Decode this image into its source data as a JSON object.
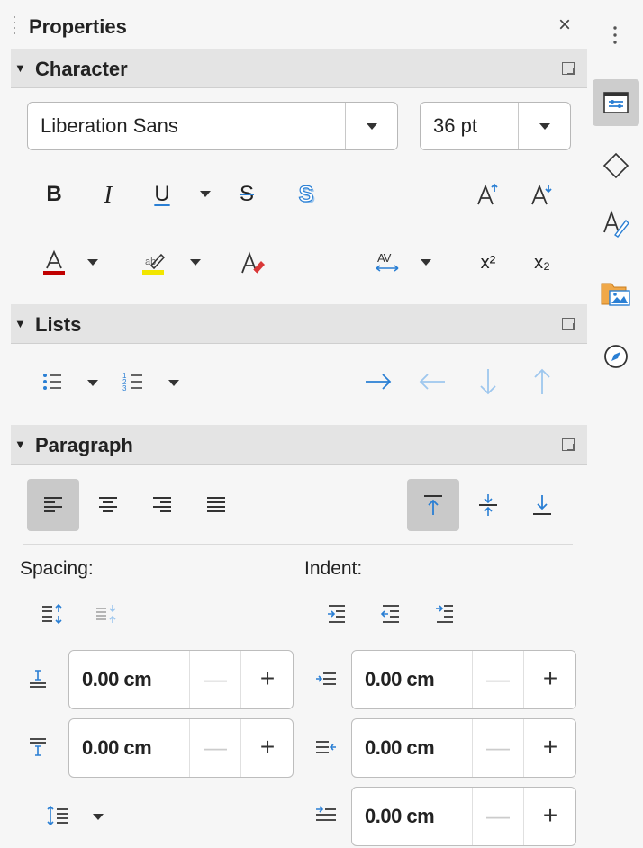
{
  "panel": {
    "title": "Properties",
    "close_glyph": "×"
  },
  "character": {
    "header": "Character",
    "font_name": "Liberation Sans",
    "font_size": "36 pt",
    "bold_label": "B",
    "italic_label": "I",
    "underline_label": "U",
    "strike_label": "S",
    "shadow_label": "S",
    "superscript_label": "x²",
    "subscript_label": "x₂"
  },
  "lists": {
    "header": "Lists"
  },
  "paragraph": {
    "header": "Paragraph",
    "spacing_label": "Spacing:",
    "indent_label": "Indent:",
    "above_spacing": "0.00 cm",
    "below_spacing": "0.00 cm",
    "before_indent": "0.00 cm",
    "after_indent": "0.00 cm",
    "first_line_indent": "0.00 cm",
    "minus_glyph": "—",
    "plus_glyph": "+"
  },
  "colors": {
    "font_color": "#c00000",
    "highlight": "#f2e600",
    "accent_blue": "#2a7fd4",
    "pale_blue": "#9ec7ee"
  },
  "tabbar": {
    "icons": [
      "properties-icon",
      "shapes-icon",
      "styles-icon",
      "gallery-icon",
      "navigator-icon"
    ]
  }
}
